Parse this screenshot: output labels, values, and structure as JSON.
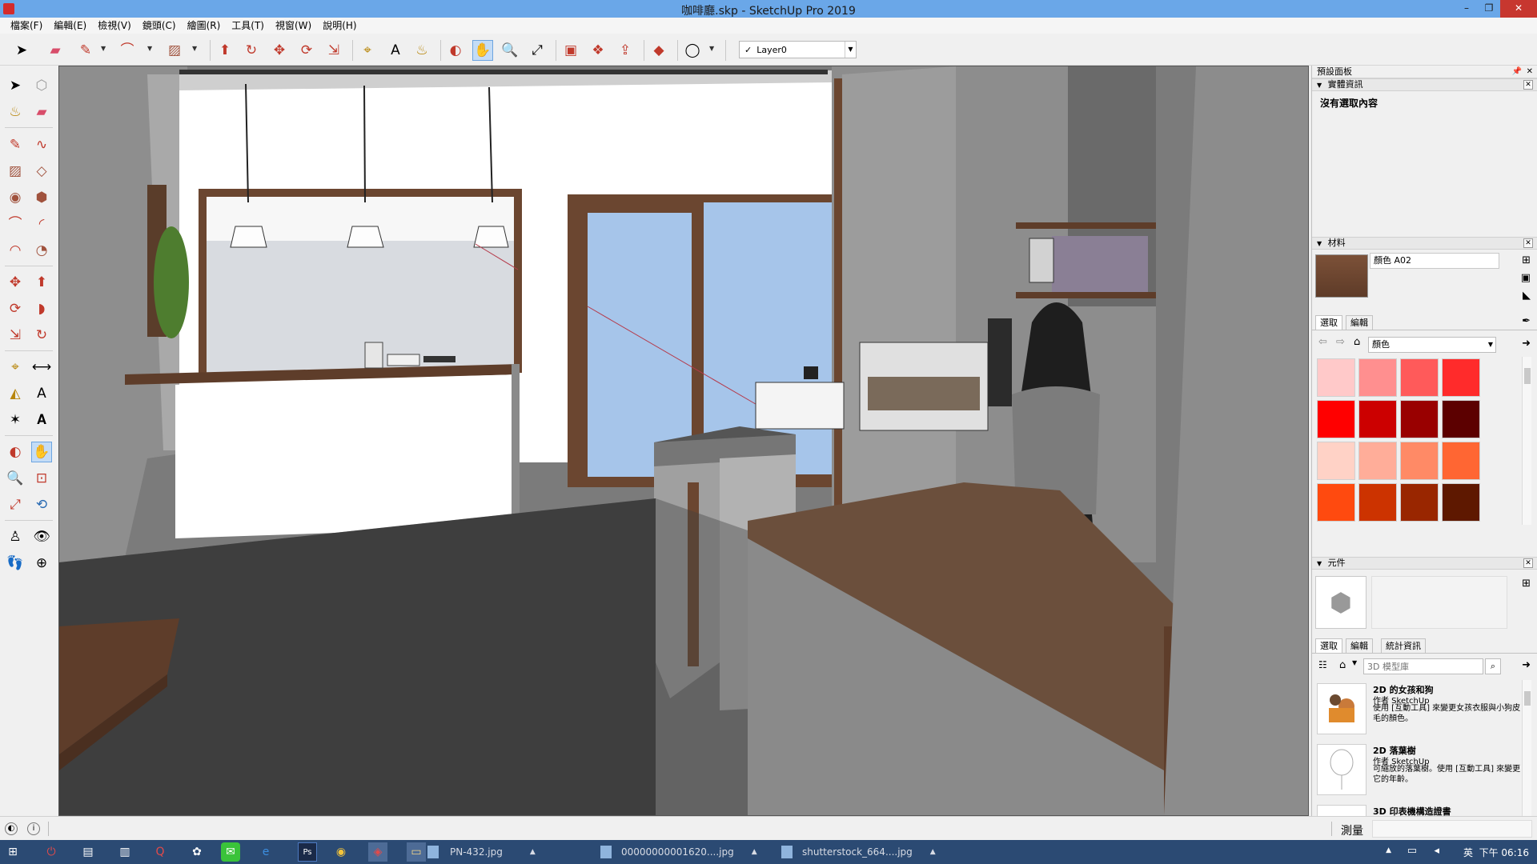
{
  "window": {
    "title": "咖啡廳.skp - SketchUp Pro 2019",
    "minimize": "–",
    "restore": "❐",
    "close": "✕"
  },
  "menu": [
    "檔案(F)",
    "編輯(E)",
    "檢視(V)",
    "鏡頭(C)",
    "繪圖(R)",
    "工具(T)",
    "視窗(W)",
    "說明(H)"
  ],
  "toolbar": {
    "layer_check": "✓",
    "layer_value": "Layer0"
  },
  "tray": {
    "title": "預設面板",
    "entity_info": {
      "header": "實體資訊",
      "text": "沒有選取內容"
    },
    "materials": {
      "header": "材料",
      "material_name": "顏色 A02",
      "tab_select": "選取",
      "tab_edit": "編輯",
      "collection": "顏色",
      "swatches": [
        "#ffc9c9",
        "#ff8f8f",
        "#ff5a5a",
        "#ff2b2b",
        "#ff0000",
        "#cc0000",
        "#990000",
        "#5c0000",
        "#ffd2c6",
        "#ffad99",
        "#ff8a66",
        "#ff6633",
        "#ff4a0f",
        "#cc3300",
        "#992600",
        "#5e1800",
        "#ffe0c4",
        "#ffcc99",
        "#ffad5c",
        "#ff9933"
      ]
    },
    "components": {
      "header": "元件",
      "tab_select": "選取",
      "tab_edit": "編輯",
      "tab_stats": "統計資訊",
      "search_placeholder": "3D 模型庫",
      "items": [
        {
          "name": "2D 的女孩和狗",
          "author": "作者 SketchUp",
          "desc": "使用 [互動工具] 來變更女孩衣服與小狗皮毛的顏色。"
        },
        {
          "name": "2D 落葉樹",
          "author": "作者 SketchUp",
          "desc": "可縮放的落葉樹。使用 [互動工具] 來變更它的年齡。"
        },
        {
          "name": "3D 印表機構造證書",
          "author": "",
          "desc": ""
        }
      ]
    }
  },
  "status": {
    "measure_label": "測量"
  },
  "taskbar": {
    "items": [
      "PN-432.jpg",
      "00000000001620....jpg",
      "shutterstock_664....jpg"
    ],
    "ime": "英",
    "clock": "下午 06:16"
  }
}
